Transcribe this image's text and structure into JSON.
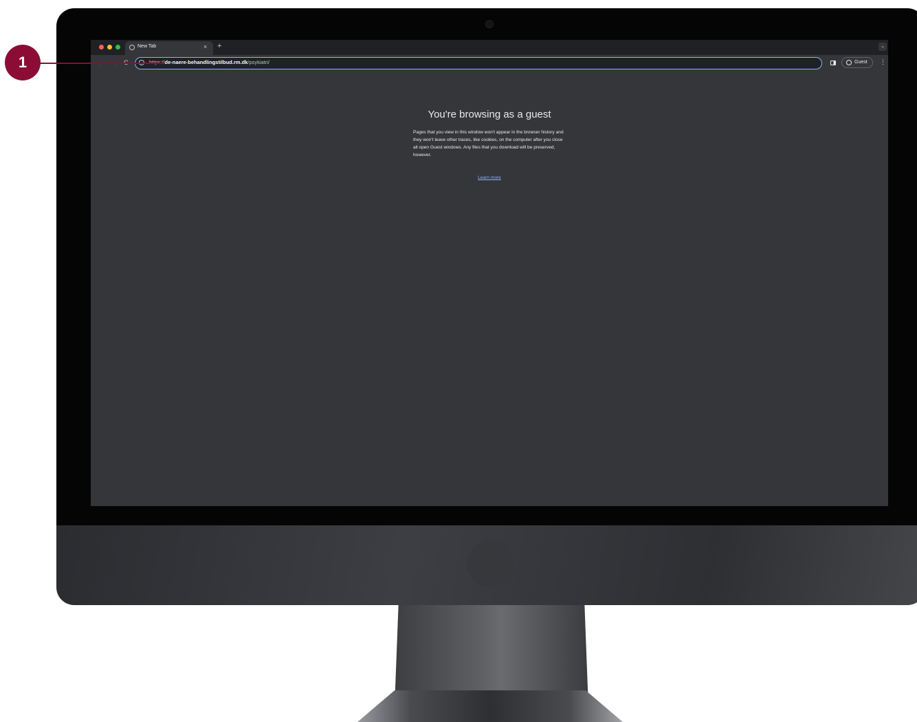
{
  "browser": {
    "tab": {
      "title": "New Tab",
      "close_glyph": "×"
    },
    "new_tab_glyph": "+",
    "tab_search_glyph": "⌄",
    "nav": {
      "back_glyph": "←",
      "forward_glyph": "→",
      "reload_glyph": "C"
    },
    "omnibox": {
      "url_scheme": "https://",
      "url_host": "de-naere-behandlingstilbud.rm.dk",
      "url_path": "/psykiatri/"
    },
    "profile": {
      "label": "Guest"
    },
    "menu_glyph": "⋮"
  },
  "page": {
    "title": "You're browsing as a guest",
    "body": "Pages that you view in this window won't appear in the browser history and they won't leave other traces, like cookies, on the computer after you close all open Guest windows. Any files that you download will be preserved, however.",
    "learn_more": "Learn more"
  },
  "callout": {
    "number": "1",
    "color": "#8b0d35"
  },
  "colors": {
    "accent": "#8ab4f8",
    "tabstrip": "#202124",
    "toolbar": "#35363a"
  },
  "icons": [
    "globe-icon",
    "site-info-icon",
    "side-panel-icon",
    "profile-icon",
    "more-menu-icon"
  ]
}
